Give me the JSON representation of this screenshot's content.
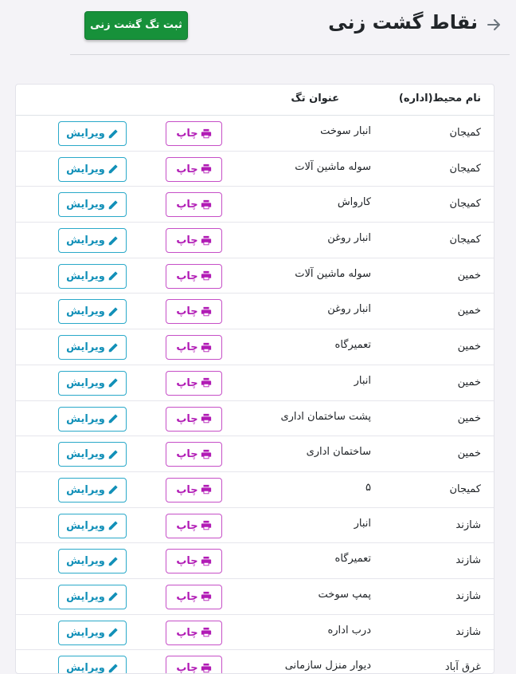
{
  "header": {
    "title": "نقاط گشت زنی",
    "add_button_label": "ثبت تگ گشت زنی"
  },
  "table": {
    "columns": [
      "نام محیط(اداره)",
      "عنوان تگ"
    ],
    "print_label": "چاپ",
    "edit_label": "ویرایش",
    "rows": [
      {
        "env": "کمیجان",
        "title": "انبار سوخت"
      },
      {
        "env": "کمیجان",
        "title": "سوله ماشین آلات"
      },
      {
        "env": "کمیجان",
        "title": "کارواش"
      },
      {
        "env": "کمیجان",
        "title": "انبار روغن"
      },
      {
        "env": "خمین",
        "title": "سوله ماشین آلات"
      },
      {
        "env": "خمین",
        "title": "انبار روغن"
      },
      {
        "env": "خمین",
        "title": "تعمیرگاه"
      },
      {
        "env": "خمین",
        "title": "انبار"
      },
      {
        "env": "خمین",
        "title": "پشت ساختمان اداری"
      },
      {
        "env": "خمین",
        "title": "ساختمان اداری"
      },
      {
        "env": "کمیجان",
        "title": "۵"
      },
      {
        "env": "شازند",
        "title": "انبار"
      },
      {
        "env": "شازند",
        "title": "تعمیرگاه"
      },
      {
        "env": "شازند",
        "title": "پمپ سوخت"
      },
      {
        "env": "شازند",
        "title": "درب اداره"
      },
      {
        "env": "غرق آباد",
        "title": "دیوار منزل سازمانی"
      }
    ]
  },
  "colors": {
    "add_button": "#17913a",
    "print_button": "#b11bb5",
    "edit_button": "#1290b8"
  }
}
